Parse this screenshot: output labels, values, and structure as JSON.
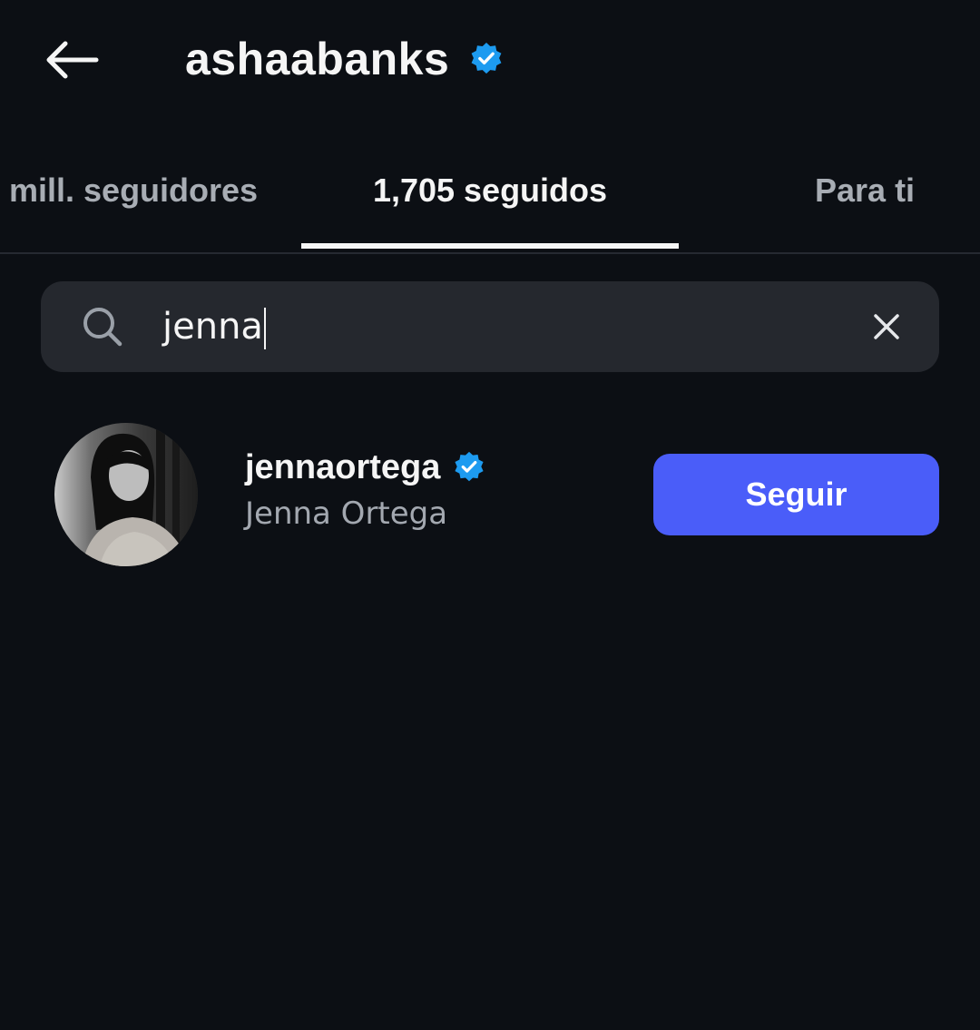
{
  "header": {
    "back_icon": "arrow-left-icon",
    "title": "ashaabanks",
    "verified_icon": "verified-badge-icon"
  },
  "tabs": [
    {
      "label": "mill. seguidores",
      "active": false
    },
    {
      "label": "1,705 seguidos",
      "active": true
    },
    {
      "label": "Para ti",
      "active": false
    }
  ],
  "search": {
    "icon": "search-icon",
    "value": "jenna",
    "clear_icon": "close-icon"
  },
  "results": [
    {
      "username": "jennaortega",
      "full_name": "Jenna Ortega",
      "verified": true,
      "follow_label": "Seguir"
    }
  ],
  "colors": {
    "background": "#0c0f14",
    "accent": "#4a5df9",
    "verified": "#1d9bf0",
    "search_bg": "#25282e",
    "muted_text": "#a3a8b0"
  }
}
